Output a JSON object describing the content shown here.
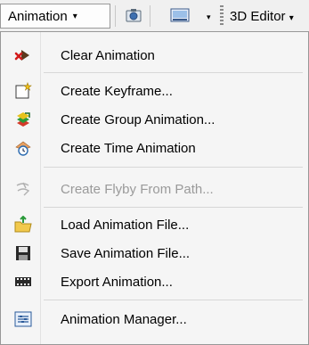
{
  "toolbar": {
    "animation_label": "Animation",
    "caret": "▾",
    "editor_label": "3D Editor",
    "editor_caret": "▾"
  },
  "menu": {
    "items": [
      {
        "label": "Clear Animation",
        "icon": "clear-animation-icon",
        "enabled": true
      },
      {
        "label": "Create Keyframe...",
        "icon": "create-keyframe-icon",
        "enabled": true
      },
      {
        "label": "Create Group Animation...",
        "icon": "group-animation-icon",
        "enabled": true
      },
      {
        "label": "Create Time Animation",
        "icon": "time-animation-icon",
        "enabled": true
      },
      {
        "label": "Create Flyby From Path...",
        "icon": "flyby-path-icon",
        "enabled": false
      },
      {
        "label": "Load Animation File...",
        "icon": "load-file-icon",
        "enabled": true
      },
      {
        "label": "Save Animation File...",
        "icon": "save-file-icon",
        "enabled": true
      },
      {
        "label": "Export Animation...",
        "icon": "export-animation-icon",
        "enabled": true
      },
      {
        "label": "Animation Manager...",
        "icon": "animation-manager-icon",
        "enabled": true
      }
    ]
  }
}
